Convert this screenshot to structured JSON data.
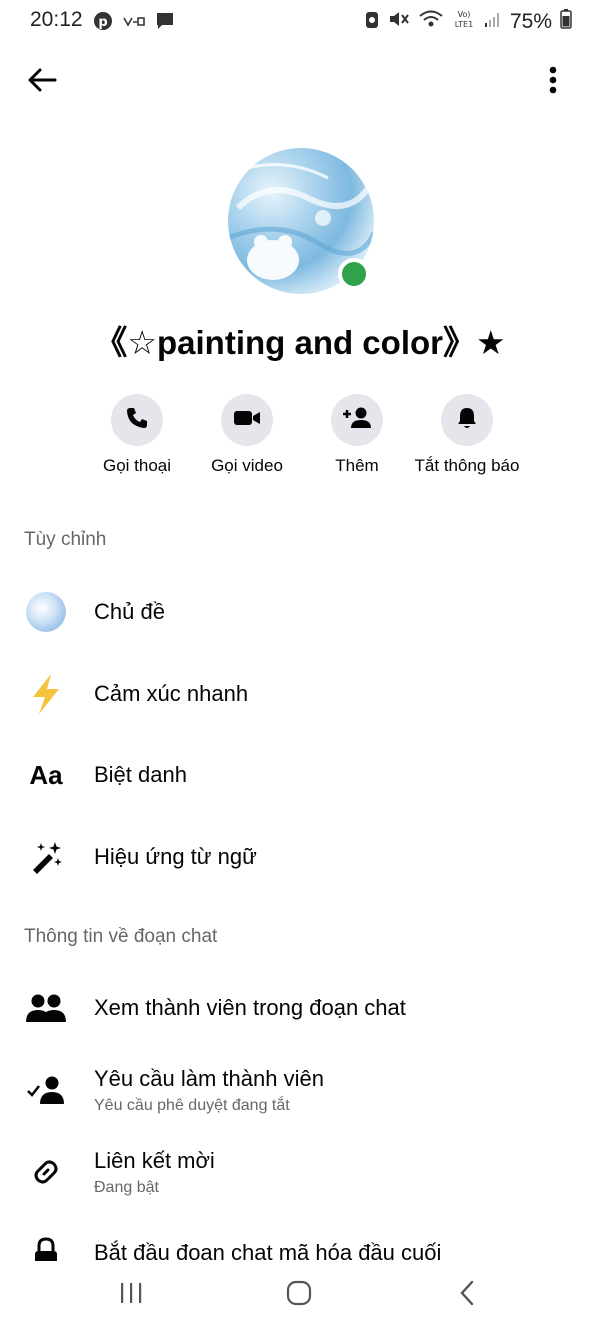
{
  "status_bar": {
    "time": "20:12",
    "battery": "75%",
    "left_icons": [
      "pinterest-icon",
      "app-icon",
      "message-icon"
    ],
    "right_icons": [
      "notification-icon",
      "mute-icon",
      "wifi-icon",
      "lte-icon",
      "signal-icon",
      "battery-icon"
    ]
  },
  "header": {
    "back_icon": "arrow-left-icon",
    "more_icon": "more-vertical-icon"
  },
  "profile": {
    "title": "《☆painting and color》★",
    "online": true,
    "online_color": "#31a24c"
  },
  "actions": [
    {
      "label": "Gọi thoại",
      "icon": "phone-icon"
    },
    {
      "label": "Gọi video",
      "icon": "video-icon"
    },
    {
      "label": "Thêm",
      "icon": "add-person-icon"
    },
    {
      "label": "Tắt thông báo",
      "icon": "bell-icon"
    }
  ],
  "sections": {
    "customize": {
      "header": "Tùy chỉnh",
      "items": [
        {
          "label": "Chủ đề",
          "icon": "theme-icon"
        },
        {
          "label": "Cảm xúc nhanh",
          "icon": "lightning-icon"
        },
        {
          "label": "Biệt danh",
          "icon": "text-aa-icon",
          "icon_text": "Aa"
        },
        {
          "label": "Hiệu ứng từ ngữ",
          "icon": "magic-wand-icon"
        }
      ]
    },
    "chat_info": {
      "header": "Thông tin về đoạn chat",
      "items": [
        {
          "label": "Xem thành viên trong đoạn chat",
          "icon": "people-icon"
        },
        {
          "label": "Yêu cầu làm thành viên",
          "sub": "Yêu cầu phê duyệt đang tắt",
          "icon": "person-check-icon"
        },
        {
          "label": "Liên kết mời",
          "sub": "Đang bật",
          "icon": "link-icon"
        },
        {
          "label": "Bắt đầu đoạn chat mã hóa đầu cuối",
          "icon": "lock-icon"
        }
      ]
    }
  },
  "navbar": {
    "icons": [
      "recent-apps-icon",
      "home-icon",
      "back-nav-icon"
    ]
  },
  "colors": {
    "accent_gray": "#e4e6eb",
    "secondary_text": "#65676b",
    "lightning": "#f5c33b"
  }
}
